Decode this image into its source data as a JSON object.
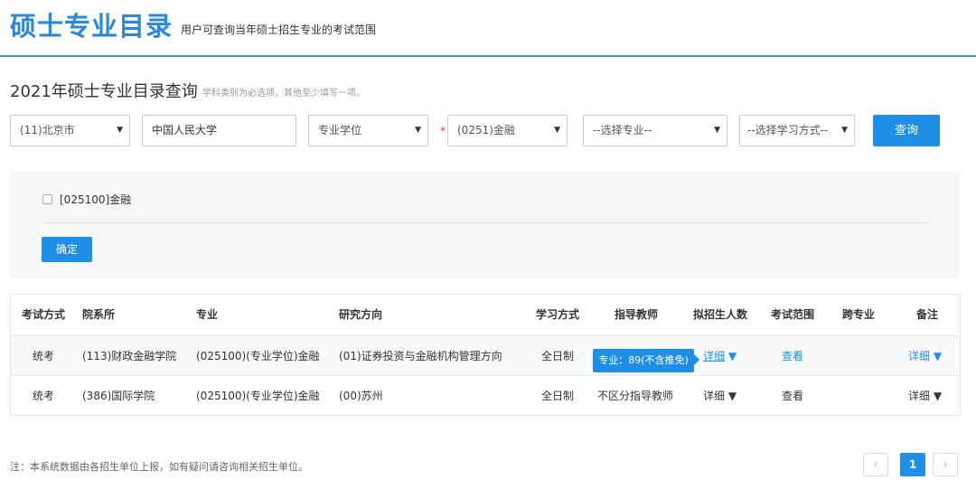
{
  "header": {
    "title": "硕士专业目录",
    "subtitle": "用户可查询当年硕士招生专业的考试范围"
  },
  "query": {
    "title": "2021年硕士专业目录查询",
    "hint": "学科类别为必选项，其他至少填写一项。",
    "province": "(11)北京市",
    "school": "中国人民大学",
    "degree_type": "专业学位",
    "required_mark": "*",
    "discipline": "(0251)金融",
    "major": "--选择专业--",
    "study_mode": "--选择学习方式--",
    "search_label": "查询"
  },
  "panel": {
    "checkbox_label": "[025100]金融",
    "confirm_label": "确定"
  },
  "table": {
    "headers": [
      "考试方式",
      "院系所",
      "专业",
      "研究方向",
      "学习方式",
      "指导教师",
      "拟招生人数",
      "考试范围",
      "跨专业",
      "备注"
    ],
    "rows": [
      {
        "exam": "统考",
        "dept": "(113)财政金融学院",
        "major": "(025100)(专业学位)金融",
        "direction": "(01)证券投资与金融机构管理方向",
        "mode": "全日制",
        "advisor": "",
        "quota": "详细",
        "scope": "查看",
        "cross": "",
        "note": "详细"
      },
      {
        "exam": "统考",
        "dept": "(386)国际学院",
        "major": "(025100)(专业学位)金融",
        "direction": "(00)苏州",
        "mode": "全日制",
        "advisor": "不区分指导教师",
        "quota": "详细",
        "scope": "查看",
        "cross": "",
        "note": "详细"
      }
    ]
  },
  "tooltip": "专业：89(不含推免)",
  "footer": {
    "note": "注：本系统数据由各招生单位上报，如有疑问请咨询相关招生单位。",
    "page": "1",
    "prev": "‹",
    "next": "›"
  },
  "colors": {
    "accent": "#1e8ee6"
  }
}
